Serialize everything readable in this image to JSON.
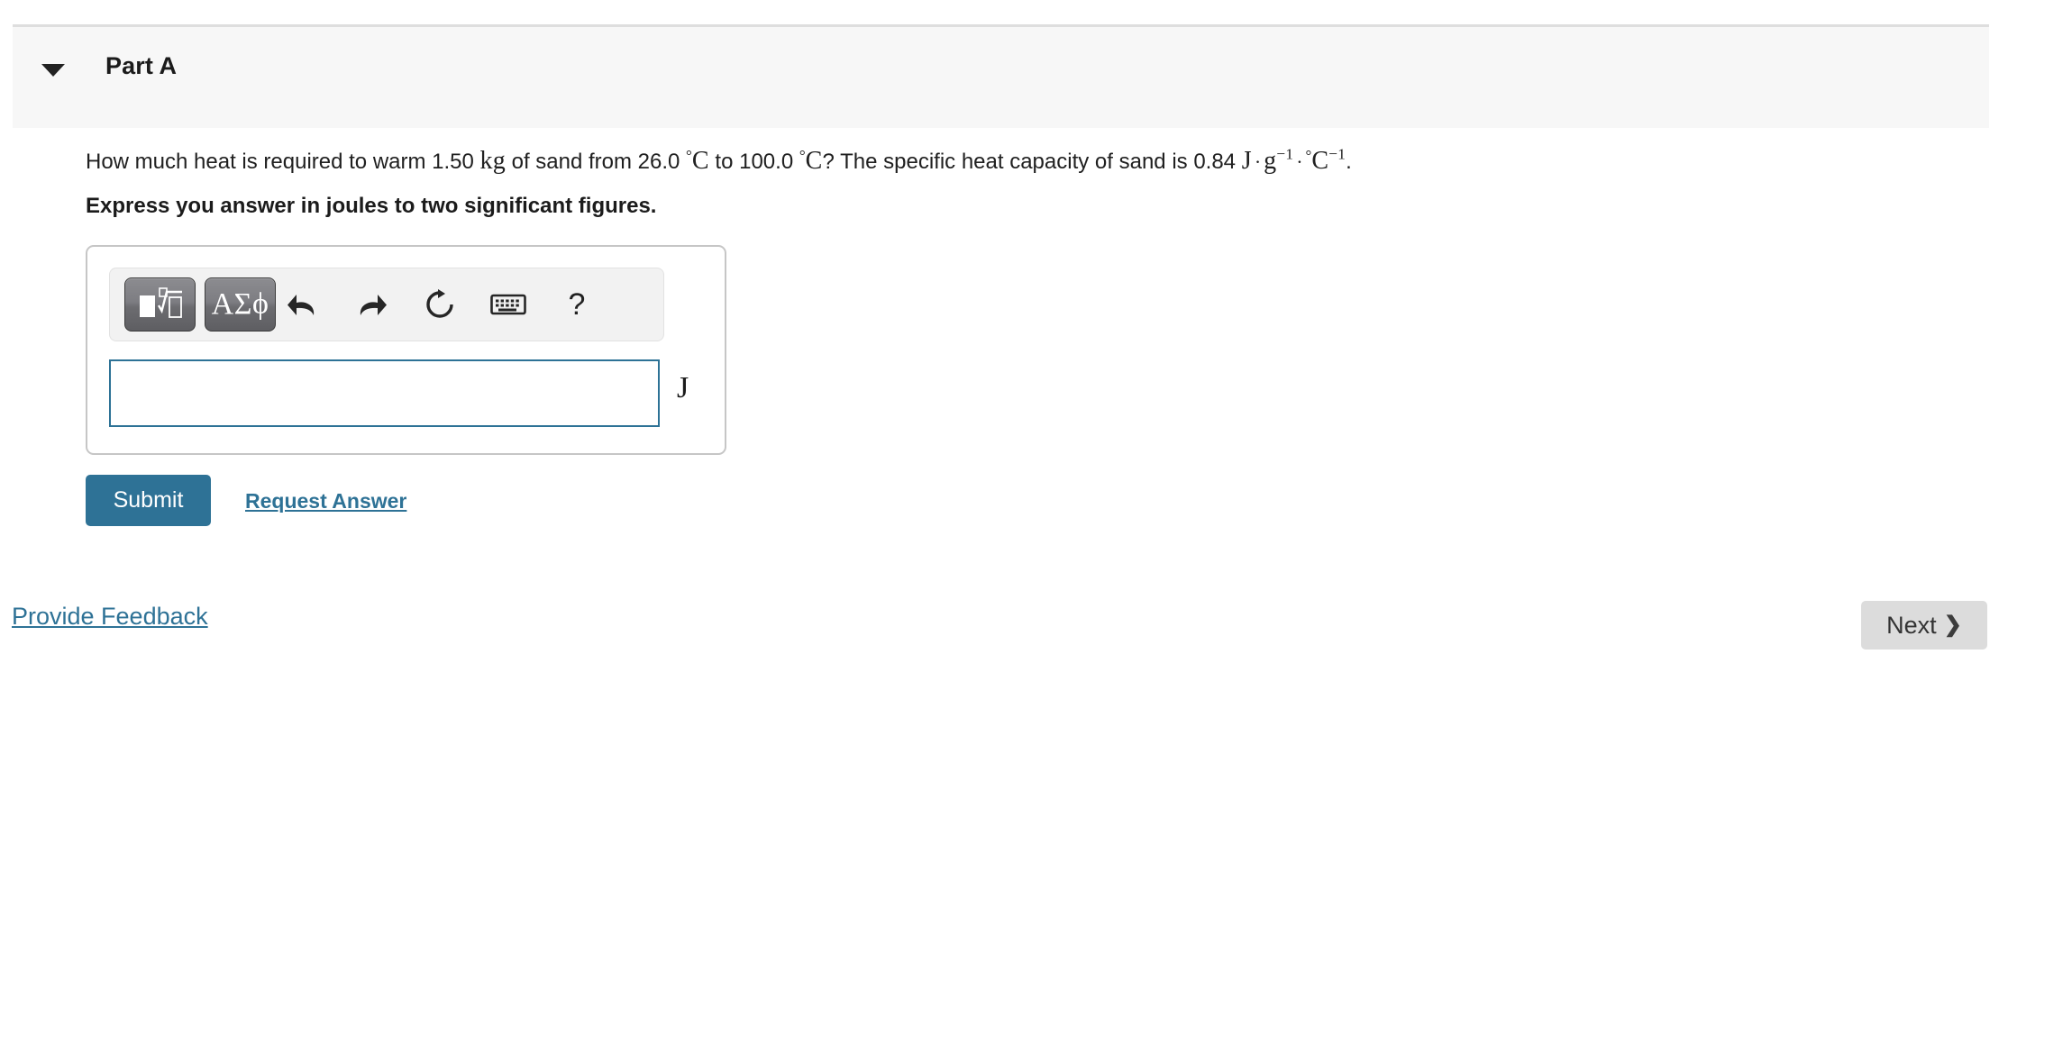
{
  "part": {
    "title": "Part A",
    "disclosure_icon": "triangle-down-icon",
    "expanded": true
  },
  "question": {
    "text_segments": {
      "s1": "How much heat is required to warm 1.50 ",
      "unit_kg": "kg",
      "s2": " of sand from 26.0 ",
      "deg1": "°",
      "c1": "C",
      "s3": " to 100.0 ",
      "deg2": "°",
      "c2": "C",
      "s4": "? The specific heat capacity of sand is 0.84 ",
      "j": "J",
      "dot1": "·",
      "g": "g",
      "g_exp": "−1",
      "dot2": "·",
      "deg3": "°",
      "c3": "C",
      "c_exp": "−1",
      "period": "."
    },
    "full_text": "How much heat is required to warm 1.50 kg of sand from 26.0 °C to 100.0 °C? The specific heat capacity of sand is 0.84 J · g−1 · °C−1.",
    "instruction": "Express you answer in joules to two significant figures."
  },
  "answer_widget": {
    "toolbar": {
      "template_button_label": "■√□",
      "greek_button_label": "ΑΣϕ",
      "icons": [
        {
          "name": "undo-icon",
          "tooltip": "Undo"
        },
        {
          "name": "redo-icon",
          "tooltip": "Redo"
        },
        {
          "name": "reset-icon",
          "tooltip": "Reset"
        },
        {
          "name": "keyboard-icon",
          "tooltip": "Keyboard shortcuts"
        },
        {
          "name": "help-icon",
          "tooltip": "Help",
          "glyph": "?"
        }
      ]
    },
    "input": {
      "value": "",
      "placeholder": ""
    },
    "unit": "J"
  },
  "actions": {
    "submit_label": "Submit",
    "request_answer_label": "Request Answer"
  },
  "footer": {
    "provide_feedback_label": "Provide Feedback",
    "next_label": "Next",
    "next_chevron": "❯"
  },
  "colors": {
    "accent_blue": "#2e7296",
    "input_border": "#2d7296",
    "header_bg": "#f7f7f7",
    "toolbar_bg": "#f2f2f2",
    "next_bg": "#dcdcdc"
  }
}
